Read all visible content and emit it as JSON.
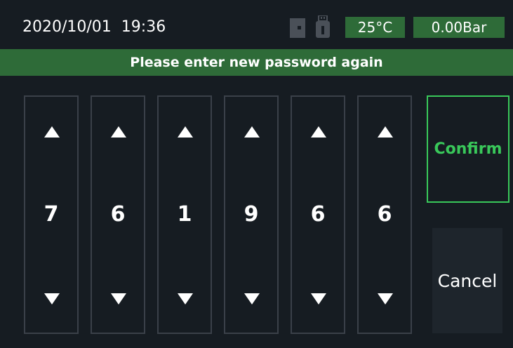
{
  "status": {
    "datetime": "2020/10/01  19:36",
    "temperature": "25°C",
    "pressure": "0.00Bar",
    "icons": [
      "sd-card-icon",
      "usb-drive-icon"
    ]
  },
  "prompt": "Please enter new password again",
  "password": {
    "digits": [
      "7",
      "6",
      "1",
      "9",
      "6",
      "6"
    ]
  },
  "buttons": {
    "confirm": "Confirm",
    "cancel": "Cancel"
  },
  "colors": {
    "background": "#161c22",
    "accent_green": "#2e6b38",
    "confirm_green": "#39c85a"
  }
}
